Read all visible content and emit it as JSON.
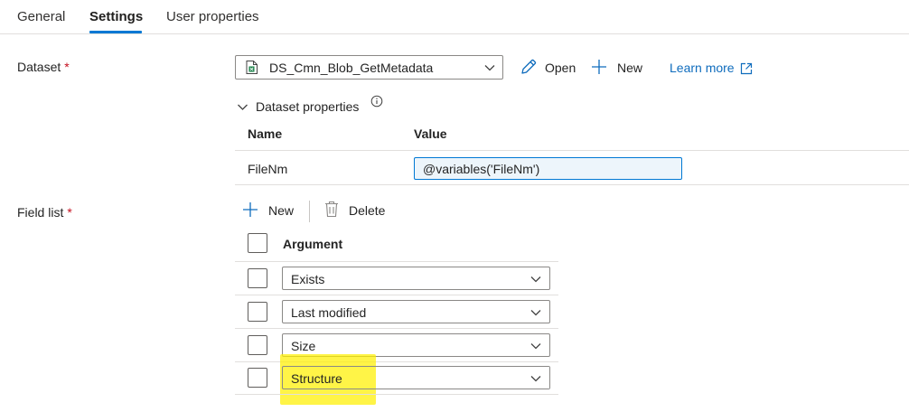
{
  "tabs": [
    {
      "label": "General",
      "active": false
    },
    {
      "label": "Settings",
      "active": true
    },
    {
      "label": "User properties",
      "active": false
    }
  ],
  "dataset": {
    "label": "Dataset",
    "required_mark": "*",
    "selected": "DS_Cmn_Blob_GetMetadata",
    "open_label": "Open",
    "new_label": "New",
    "learn_more_label": "Learn more"
  },
  "dataset_properties": {
    "title": "Dataset properties",
    "columns": {
      "name": "Name",
      "value": "Value"
    },
    "rows": [
      {
        "name": "FileNm",
        "value": "@variables('FileNm')"
      }
    ]
  },
  "field_list": {
    "label": "Field list",
    "required_mark": "*",
    "new_label": "New",
    "delete_label": "Delete",
    "column_header": "Argument",
    "items": [
      {
        "value": "Exists"
      },
      {
        "value": "Last modified"
      },
      {
        "value": "Size"
      },
      {
        "value": "Structure",
        "highlighted": true
      }
    ]
  },
  "colors": {
    "accent": "#0078d4",
    "link": "#0f6cbd",
    "required": "#c50f1f",
    "highlight": "#fff000"
  }
}
